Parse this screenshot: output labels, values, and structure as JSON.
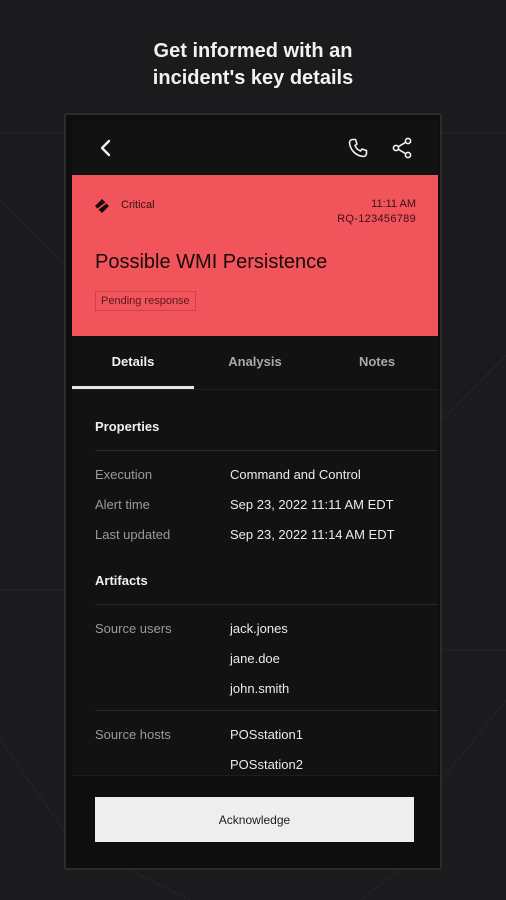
{
  "headline": {
    "line1": "Get informed with an",
    "line2": "incident's key details"
  },
  "topbar": {
    "back_icon": "chevron-left-icon",
    "call_icon": "phone-icon",
    "share_icon": "share-icon"
  },
  "incident": {
    "severity": "Critical",
    "severity_icon": "critical-severity-icon",
    "time": "11:11 AM",
    "reference": "RQ-123456789",
    "title": "Possible WMI Persistence",
    "status": "Pending response",
    "accent_color": "#f2545b"
  },
  "tabs": [
    {
      "label": "Details",
      "active": true
    },
    {
      "label": "Analysis",
      "active": false
    },
    {
      "label": "Notes",
      "active": false
    }
  ],
  "properties": {
    "heading": "Properties",
    "rows": [
      {
        "label": "Execution",
        "value": "Command and Control"
      },
      {
        "label": "Alert time",
        "value": "Sep 23, 2022 11:11 AM EDT"
      },
      {
        "label": "Last updated",
        "value": "Sep 23, 2022 11:14 AM EDT"
      }
    ]
  },
  "artifacts": {
    "heading": "Artifacts",
    "source_users_label": "Source users",
    "source_users": [
      "jack.jones",
      "jane.doe",
      "john.smith"
    ],
    "source_hosts_label": "Source hosts",
    "source_hosts": [
      "POSstation1",
      "POSstation2"
    ]
  },
  "footer": {
    "acknowledge_label": "Acknowledge"
  }
}
